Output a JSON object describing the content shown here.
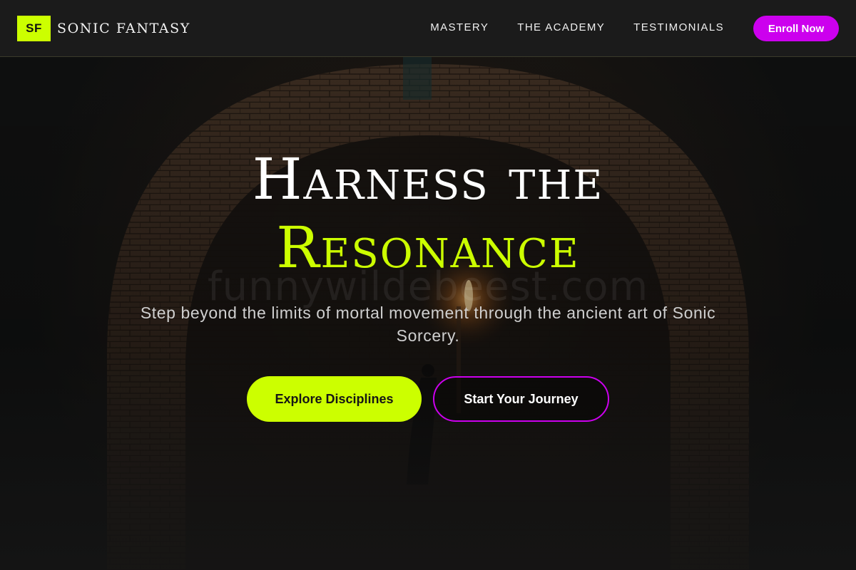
{
  "header": {
    "logo_mark": "SF",
    "logo_text": "SONIC FANTASY",
    "nav": [
      {
        "label": "MASTERY"
      },
      {
        "label": "THE ACADEMY"
      },
      {
        "label": "TESTIMONIALS"
      }
    ],
    "enroll_label": "Enroll Now"
  },
  "hero": {
    "title_line1": "Harness the",
    "title_line2": "Resonance",
    "subtitle": "Step beyond the limits of mortal movement through the ancient art of Sonic Sorcery.",
    "watermark": "funnywildebeest.com",
    "primary_cta": "Explore Disciplines",
    "secondary_cta": "Start Your Journey"
  },
  "colors": {
    "accent_lime": "#ccff00",
    "accent_purple": "#cc00ee",
    "background": "#161616"
  }
}
